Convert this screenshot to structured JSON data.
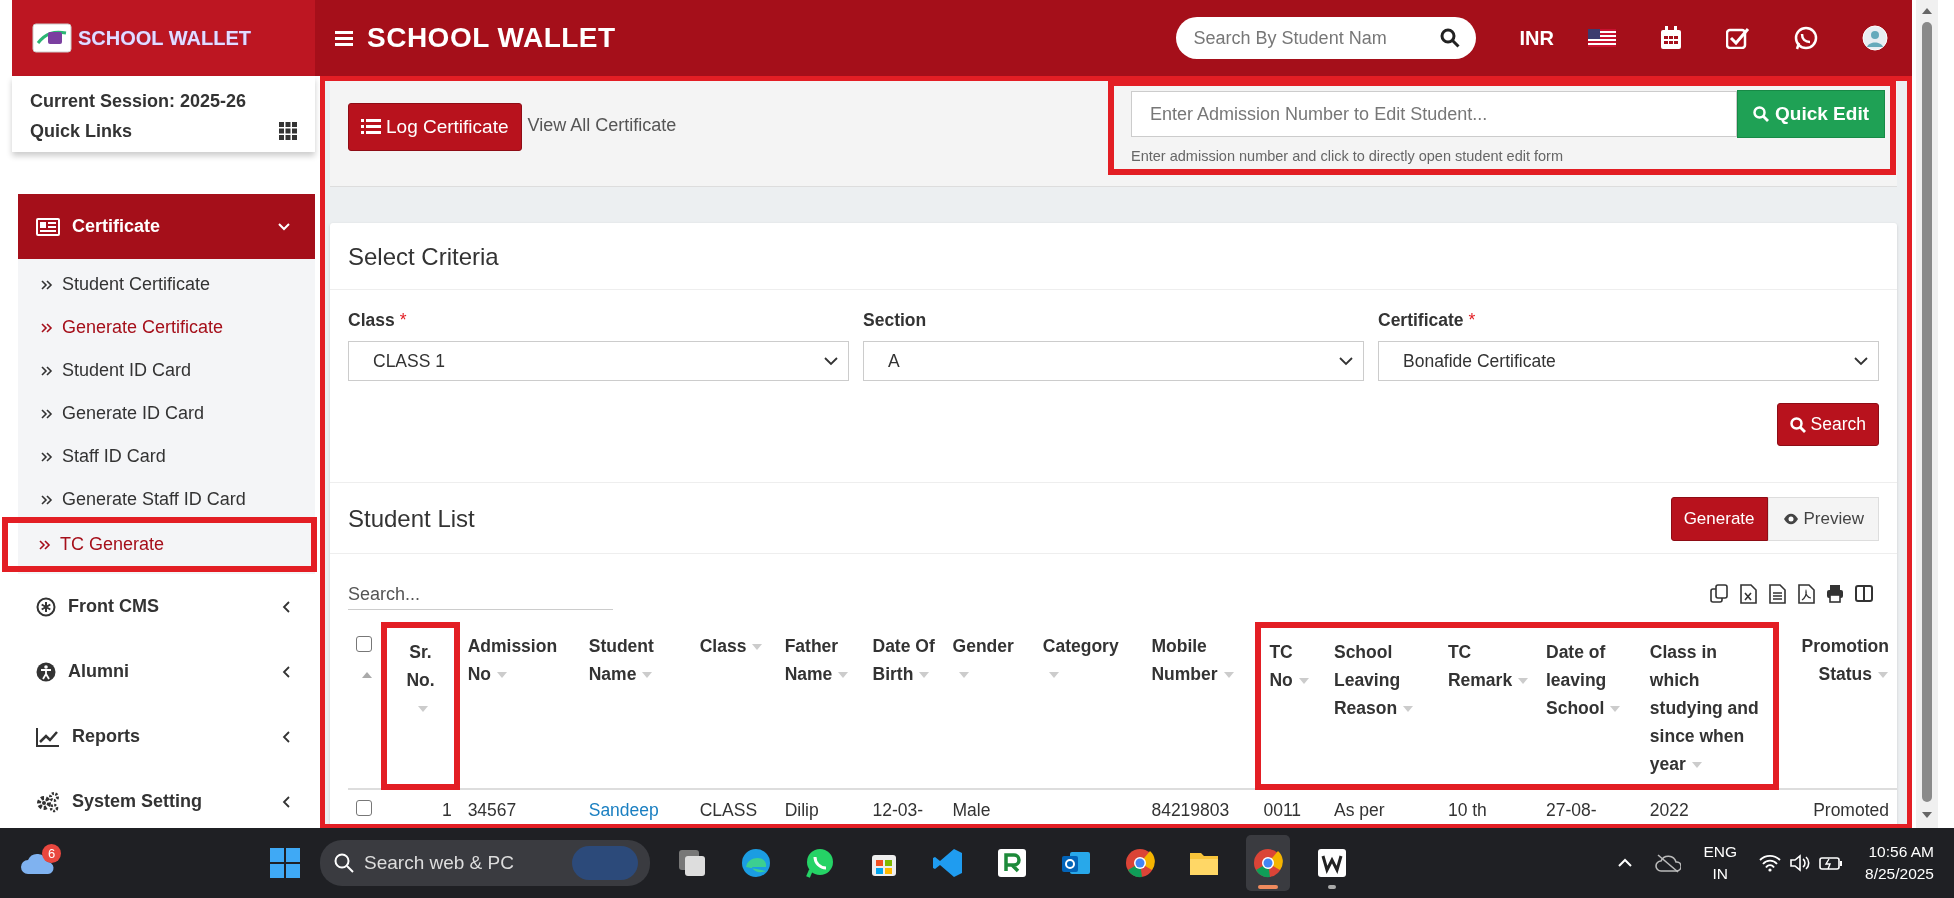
{
  "topbar": {
    "logo_text": "SCHOOL WALLET",
    "title": "SCHOOL WALLET",
    "search": {
      "placeholder": "Search By Student Nam"
    },
    "currency": "INR"
  },
  "sidebar": {
    "session": "Current Session: 2025-26",
    "quick_links": "Quick Links",
    "menu": [
      {
        "label": "Certificate",
        "expanded": true,
        "children": [
          {
            "label": "Student Certificate",
            "selected": false,
            "highlighted": false
          },
          {
            "label": "Generate Certificate",
            "selected": true,
            "highlighted": false
          },
          {
            "label": "Student ID Card",
            "selected": false,
            "highlighted": false
          },
          {
            "label": "Generate ID Card",
            "selected": false,
            "highlighted": false
          },
          {
            "label": "Staff ID Card",
            "selected": false,
            "highlighted": false
          },
          {
            "label": "Generate Staff ID Card",
            "selected": false,
            "highlighted": false
          },
          {
            "label": "TC Generate",
            "selected": true,
            "highlighted": true
          }
        ]
      },
      {
        "label": "Front CMS",
        "expanded": false
      },
      {
        "label": "Alumni",
        "expanded": false
      },
      {
        "label": "Reports",
        "expanded": false
      },
      {
        "label": "System Setting",
        "expanded": false
      }
    ]
  },
  "content": {
    "highlighted": true,
    "toolbar": {
      "log_button": "Log Certificate",
      "view_all": "View All Certificate",
      "quick_edit": {
        "highlighted": true,
        "placeholder": "Enter Admission Number to Edit Student...",
        "button": "Quick Edit",
        "hint": "Enter admission number and click to directly open student edit form"
      }
    },
    "criteria": {
      "title": "Select Criteria",
      "fields": [
        {
          "label": "Class",
          "required_mark": "*",
          "value": "CLASS 1"
        },
        {
          "label": "Section",
          "value": "A"
        },
        {
          "label": "Certificate",
          "required_mark": "*",
          "value": "Bonafide Certificate"
        }
      ],
      "search_button": "Search"
    },
    "student_list": {
      "title": "Student List",
      "generate_button": "Generate",
      "preview_button": "Preview",
      "search": {
        "placeholder": "Search..."
      },
      "select_all_checked": false,
      "columns": [
        {
          "label": "Sr. No.",
          "highlighted": true
        },
        {
          "label": "Admission No",
          "highlighted": false
        },
        {
          "label": "Student Name",
          "highlighted": false
        },
        {
          "label": "Class",
          "highlighted": false
        },
        {
          "label": "Father Name",
          "highlighted": false
        },
        {
          "label": "Date Of Birth",
          "highlighted": false
        },
        {
          "label": "Gender",
          "highlighted": false
        },
        {
          "label": "Category",
          "highlighted": false
        },
        {
          "label": "Mobile Number",
          "highlighted": false
        },
        {
          "label": "TC No",
          "highlighted": true
        },
        {
          "label": "School Leaving Reason",
          "highlighted": true
        },
        {
          "label": "TC Remark",
          "highlighted": true
        },
        {
          "label": "Date of leaving School",
          "highlighted": true
        },
        {
          "label": "Class in which studying and since when year",
          "highlighted": true
        },
        {
          "label": "Promotion Status",
          "highlighted": false
        }
      ],
      "rows": [
        {
          "checked": false,
          "cells": [
            "1",
            "34567",
            "Sandeep",
            "CLASS",
            "Dilip",
            "12-03-",
            "Male",
            "",
            "84219803",
            "0011",
            "As per",
            "10 th",
            "27-08-",
            "2022",
            "Promoted"
          ]
        }
      ]
    }
  },
  "taskbar": {
    "weather_badge": "6",
    "search": "Search web & PC",
    "apps": [
      {
        "kind": "taskview",
        "focused": false,
        "running": false
      },
      {
        "kind": "edge",
        "focused": false,
        "running": false
      },
      {
        "kind": "whatsapp",
        "focused": false,
        "running": false
      },
      {
        "kind": "store",
        "focused": false,
        "running": false
      },
      {
        "kind": "vscode",
        "focused": false,
        "running": false
      },
      {
        "kind": "rapp",
        "focused": false,
        "running": false
      },
      {
        "kind": "outlook",
        "focused": false,
        "running": false
      },
      {
        "kind": "chrome",
        "focused": false,
        "running": false
      },
      {
        "kind": "files",
        "focused": false,
        "running": false
      },
      {
        "kind": "chrome",
        "focused": true,
        "running": true
      },
      {
        "kind": "wapp",
        "focused": false,
        "running": true
      }
    ],
    "language": "ENG",
    "region": "IN",
    "time": "10:56 AM",
    "date": "8/25/2025"
  }
}
